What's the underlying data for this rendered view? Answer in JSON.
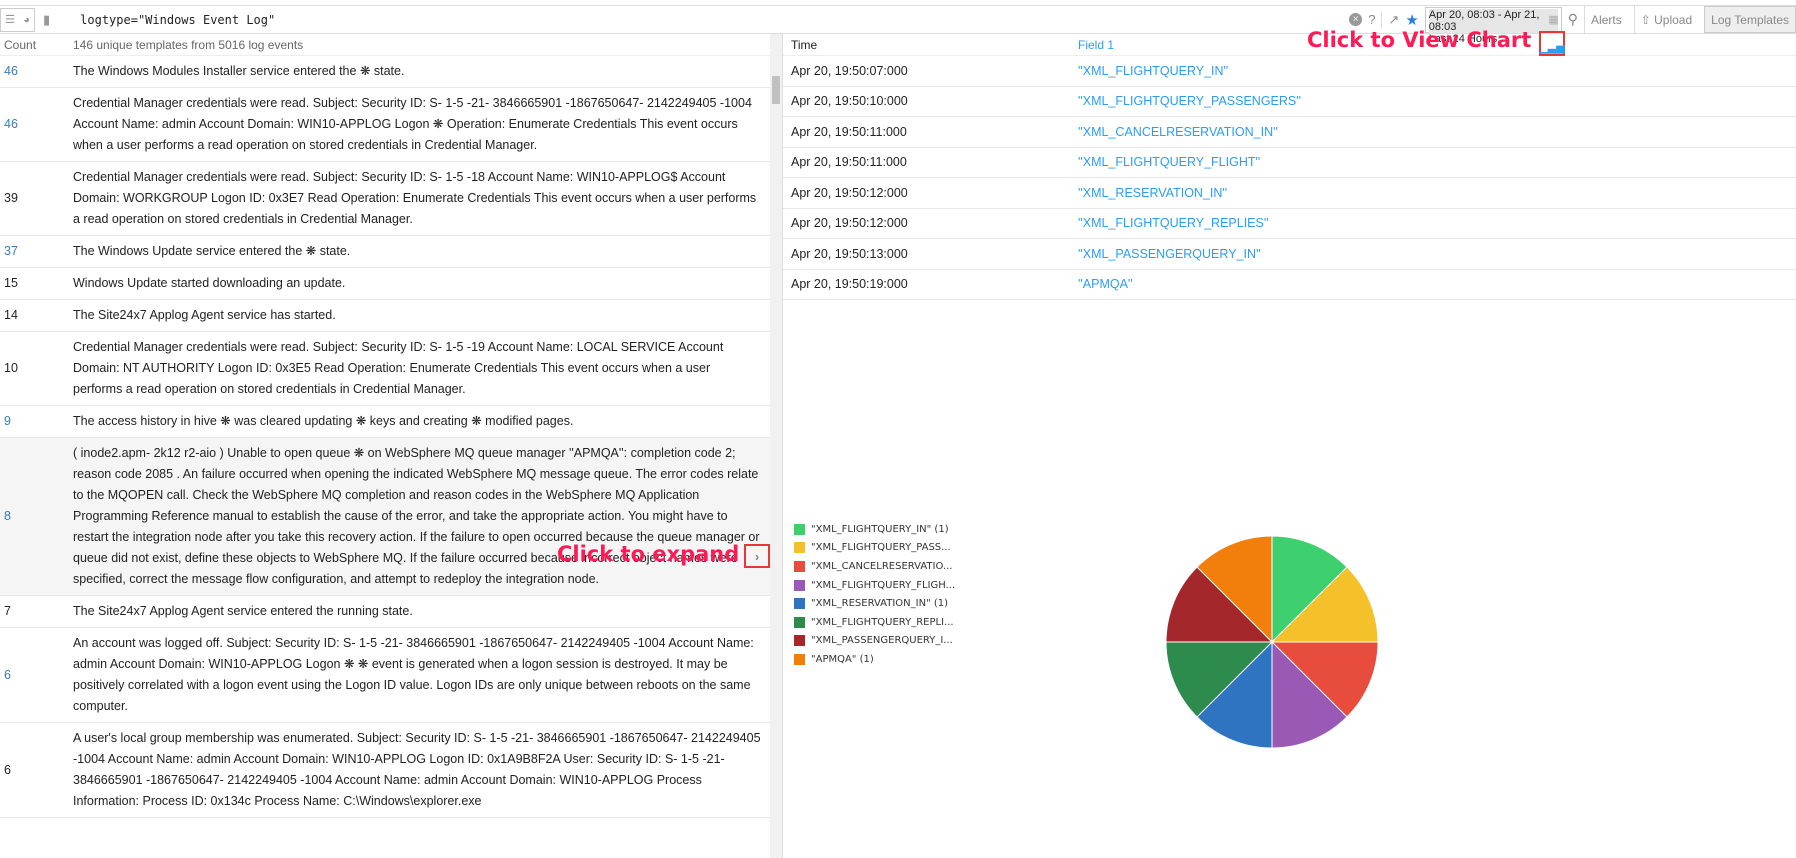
{
  "search": {
    "query": "logtype=\"Windows Event Log\""
  },
  "toolbar": {
    "date_range": "Apr 20, 08:03 - Apr 21, 08:03",
    "date_preset": "Last 24 Hours",
    "alerts": "Alerts",
    "upload": "Upload",
    "log_templates": "Log Templates",
    "help": "?"
  },
  "left": {
    "count_header": "Count",
    "summary": "146 unique templates from 5016 log events",
    "rows": [
      {
        "count": "46",
        "link": true,
        "text": "The Windows Modules Installer service entered the ❋ state."
      },
      {
        "count": "46",
        "link": true,
        "text": "Credential Manager credentials were read. Subject: Security ID: S- 1-5 -21- 3846665901 -1867650647- 2142249405 -1004 Account Name: admin Account Domain: WIN10-APPLOG Logon ❋ Operation: Enumerate Credentials This event occurs when a user performs a read operation on stored credentials in Credential Manager."
      },
      {
        "count": "39",
        "link": false,
        "text": "Credential Manager credentials were read. Subject: Security ID: S- 1-5 -18 Account Name: WIN10-APPLOG$ Account Domain: WORKGROUP Logon ID: 0x3E7 Read Operation: Enumerate Credentials This event occurs when a user performs a read operation on stored credentials in Credential Manager."
      },
      {
        "count": "37",
        "link": true,
        "text": "The Windows Update service entered the ❋ state."
      },
      {
        "count": "15",
        "link": false,
        "text": "Windows Update started downloading an update."
      },
      {
        "count": "14",
        "link": false,
        "text": "The Site24x7 Applog Agent service has started."
      },
      {
        "count": "10",
        "link": false,
        "text": "Credential Manager credentials were read. Subject: Security ID: S- 1-5 -19 Account Name: LOCAL SERVICE Account Domain: NT AUTHORITY Logon ID: 0x3E5 Read Operation: Enumerate Credentials This event occurs when a user performs a read operation on stored credentials in Credential Manager."
      },
      {
        "count": "9",
        "link": true,
        "text": "The access history in hive ❋ was cleared updating ❋ keys and creating ❋ modified pages."
      },
      {
        "count": "8",
        "link": true,
        "selected": true,
        "text": "( inode2.apm- 2k12 r2-aio ) Unable to open queue ❋ on WebSphere MQ queue manager ''APMQA'': completion code 2; reason code 2085 . An failure occurred when opening the indicated WebSphere MQ message queue. The error codes relate to the MQOPEN call. Check the WebSphere MQ completion and reason codes in the WebSphere MQ Application Programming Reference manual to establish the cause of the error, and take the appropriate action. You might have to restart the integration node after you take this recovery action. If the failure to open occurred because the queue manager or queue did not exist, define these objects to WebSphere MQ. If the failure occurred because incorrect object names were specified, correct the message flow configuration, and attempt to redeploy the integration node."
      },
      {
        "count": "7",
        "link": false,
        "text": "The Site24x7 Applog Agent service entered the running state."
      },
      {
        "count": "6",
        "link": true,
        "text": "An account was logged off. Subject: Security ID: S- 1-5 -21- 3846665901 -1867650647- 2142249405 -1004 Account Name: admin Account Domain: WIN10-APPLOG Logon ❋ ❋ event is generated when a logon session is destroyed. It may be positively correlated with a logon event using the Logon ID value. Logon IDs are only unique between reboots on the same computer."
      },
      {
        "count": "6",
        "link": false,
        "text": "A user's local group membership was enumerated. Subject: Security ID: S- 1-5 -21- 3846665901 -1867650647- 2142249405 -1004 Account Name: admin Account Domain: WIN10-APPLOG Logon ID: 0x1A9B8F2A User: Security ID: S- 1-5 -21- 3846665901 -1867650647- 2142249405 -1004 Account Name: admin Account Domain: WIN10-APPLOG Process Information: Process ID: 0x134c Process Name: C:\\Windows\\explorer.exe"
      }
    ]
  },
  "right": {
    "time_header": "Time",
    "field_header": "Field 1",
    "rows": [
      {
        "time": "Apr 20, 19:50:07:000",
        "field": "''XML_FLIGHTQUERY_IN''"
      },
      {
        "time": "Apr 20, 19:50:10:000",
        "field": "''XML_FLIGHTQUERY_PASSENGERS''"
      },
      {
        "time": "Apr 20, 19:50:11:000",
        "field": "''XML_CANCELRESERVATION_IN''"
      },
      {
        "time": "Apr 20, 19:50:11:000",
        "field": "''XML_FLIGHTQUERY_FLIGHT''"
      },
      {
        "time": "Apr 20, 19:50:12:000",
        "field": "''XML_RESERVATION_IN''"
      },
      {
        "time": "Apr 20, 19:50:12:000",
        "field": "''XML_FLIGHTQUERY_REPLIES''"
      },
      {
        "time": "Apr 20, 19:50:13:000",
        "field": "''XML_PASSENGERQUERY_IN''"
      },
      {
        "time": "Apr 20, 19:50:19:000",
        "field": "''APMQA''"
      }
    ]
  },
  "annotations": {
    "view_chart": "Click to View Chart",
    "expand": "Click to expand"
  },
  "chart_data": {
    "type": "pie",
    "legend_position": "left",
    "slices": [
      {
        "label": "\"XML_FLIGHTQUERY_IN\" (1)",
        "value": 1,
        "color": "#3ecf6e"
      },
      {
        "label": "\"XML_FLIGHTQUERY_PASS...",
        "value": 1,
        "color": "#f5c12a"
      },
      {
        "label": "\"XML_CANCELRESERVATIO...",
        "value": 1,
        "color": "#e74c3c"
      },
      {
        "label": "\"XML_FLIGHTQUERY_FLIGH...",
        "value": 1,
        "color": "#9b59b6"
      },
      {
        "label": "\"XML_RESERVATION_IN\" (1)",
        "value": 1,
        "color": "#2f74c0"
      },
      {
        "label": "\"XML_FLIGHTQUERY_REPLI...",
        "value": 1,
        "color": "#2e8b4e"
      },
      {
        "label": "\"XML_PASSENGERQUERY_I...",
        "value": 1,
        "color": "#a4282b"
      },
      {
        "label": "\"APMQA\" (1)",
        "value": 1,
        "color": "#f27f0c"
      }
    ]
  }
}
